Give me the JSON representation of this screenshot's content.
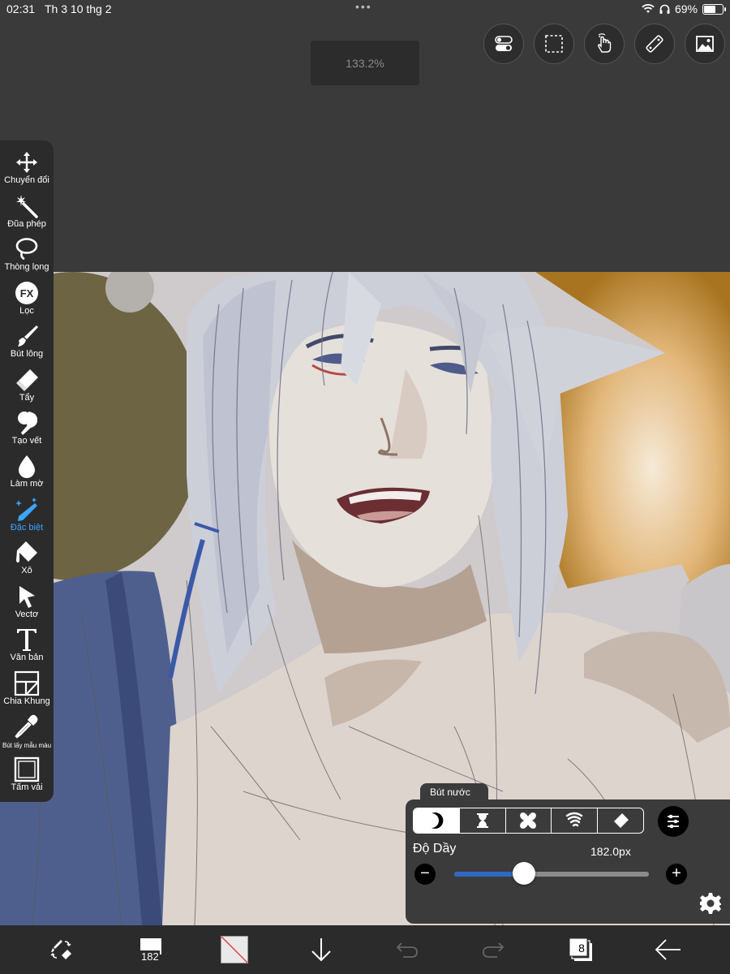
{
  "status_bar": {
    "time": "02:31",
    "date": "Th 3 10 thg 2",
    "dots": "•••",
    "battery": "69%",
    "battery_level": 0.69
  },
  "zoom": {
    "value": "133.2%"
  },
  "top_buttons": [
    "toggle-icon",
    "selection-icon",
    "hand-icon",
    "ruler-icon",
    "image-icon"
  ],
  "tools": [
    {
      "label": "Chuyển đổi",
      "icon": "move-icon"
    },
    {
      "label": "Đũa phép",
      "icon": "magic-wand-icon"
    },
    {
      "label": "Thòng lọng",
      "icon": "lasso-icon"
    },
    {
      "label": "Lọc",
      "icon": "fx-icon"
    },
    {
      "label": "Bút lông",
      "icon": "brush-icon"
    },
    {
      "label": "Tẩy",
      "icon": "eraser-icon"
    },
    {
      "label": "Tạo vết",
      "icon": "smudge-icon"
    },
    {
      "label": "Làm mờ",
      "icon": "blur-icon"
    },
    {
      "label": "Đặc biệt",
      "icon": "special-pen-icon",
      "active": true
    },
    {
      "label": "Xô",
      "icon": "bucket-icon"
    },
    {
      "label": "Vectơ",
      "icon": "vector-icon"
    },
    {
      "label": "Văn bản",
      "icon": "text-icon"
    },
    {
      "label": "Chia Khung",
      "icon": "frame-icon"
    },
    {
      "label": "Bút lấy mẫu màu",
      "icon": "eyedropper-icon"
    },
    {
      "label": "Tấm vải",
      "icon": "canvas-icon"
    }
  ],
  "brush_panel": {
    "tab": "Bút nước",
    "modes": [
      "moon-icon",
      "hourglass-icon",
      "spark-icon",
      "wave-icon",
      "eraser-icon"
    ],
    "selected_mode": 0,
    "thickness_label": "Độ Dầy",
    "thickness_value": "182.0px",
    "slider_fraction": 0.36,
    "minus": "−",
    "plus": "+"
  },
  "bottom_bar": {
    "brush_size": "182",
    "layer_count": "8"
  },
  "colors": {
    "accent": "#3aa6ff",
    "slider": "#2f6ac2",
    "panel": "#3b3b3c",
    "toolbar": "#2b2b2c"
  }
}
